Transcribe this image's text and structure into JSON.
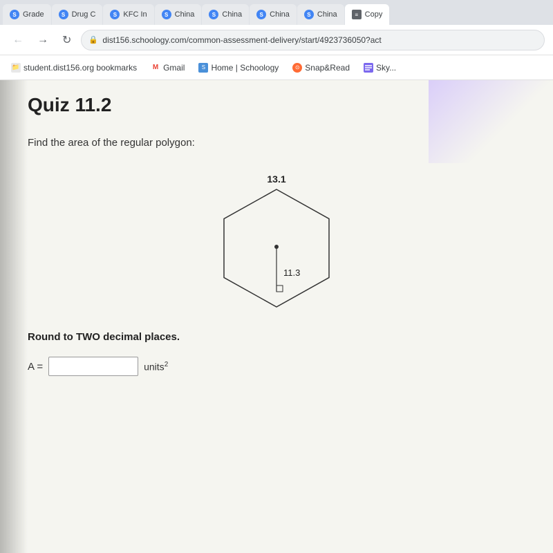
{
  "browser": {
    "tabs": [
      {
        "id": "grade",
        "label": "Grade",
        "icon": "S",
        "icon_color": "blue",
        "active": false
      },
      {
        "id": "drug",
        "label": "Drug C",
        "icon": "S",
        "icon_color": "blue",
        "active": false
      },
      {
        "id": "kfc",
        "label": "KFC In",
        "icon": "S",
        "icon_color": "blue",
        "active": false
      },
      {
        "id": "china1",
        "label": "China",
        "icon": "S",
        "icon_color": "blue",
        "active": false
      },
      {
        "id": "china2",
        "label": "China",
        "icon": "S",
        "icon_color": "blue",
        "active": false
      },
      {
        "id": "china3",
        "label": "China",
        "icon": "S",
        "icon_color": "blue",
        "active": false
      },
      {
        "id": "china4",
        "label": "China",
        "icon": "S",
        "icon_color": "blue",
        "active": false
      },
      {
        "id": "copy",
        "label": "Copy",
        "icon": "≡",
        "icon_color": "lines",
        "active": true
      }
    ],
    "address_bar": {
      "url": "dist156.schoology.com/common-assessment-delivery/start/4923736050?act",
      "lock_icon": "🔒"
    },
    "bookmarks": [
      {
        "id": "student",
        "label": "student.dist156.org bookmarks",
        "type": "folder"
      },
      {
        "id": "gmail",
        "label": "Gmail",
        "type": "gmail"
      },
      {
        "id": "schoology",
        "label": "Home | Schoology",
        "type": "schoology"
      },
      {
        "id": "snapread",
        "label": "Snap&Read",
        "type": "snap"
      },
      {
        "id": "sky",
        "label": "Sky...",
        "type": "sky"
      }
    ]
  },
  "page": {
    "title": "Quiz 11.2",
    "question_text": "Find the area of the regular polygon:",
    "polygon_label_top": "13.1",
    "polygon_label_apothem": "11.3",
    "round_instruction": "Round to TWO decimal places.",
    "answer_label": "A =",
    "answer_placeholder": "",
    "units_label": "units",
    "units_superscript": "2"
  }
}
